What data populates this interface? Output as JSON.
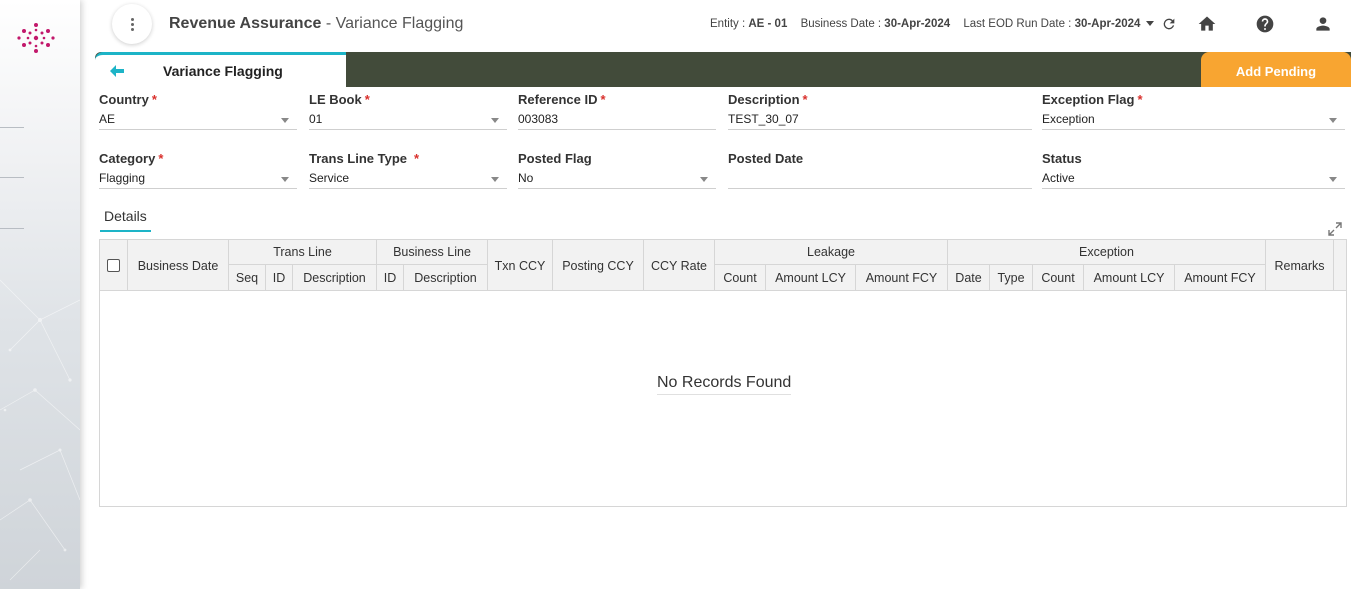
{
  "header": {
    "app_title": "Revenue Assurance",
    "page_title": " - Variance Flagging",
    "entity_label": "Entity : ",
    "entity_value": "AE - 01",
    "business_date_label": "Business Date : ",
    "business_date_value": "30-Apr-2024",
    "eod_label": "Last EOD Run Date : ",
    "eod_value": "30-Apr-2024",
    "icons": [
      "refresh-icon",
      "home-icon",
      "help-icon",
      "user-icon"
    ]
  },
  "tab": {
    "label": "Variance Flagging",
    "back_icon": "arrow-left-icon"
  },
  "actions": {
    "add_pending": "Add Pending"
  },
  "form": {
    "country": {
      "label": "Country",
      "required": "*",
      "value": "AE"
    },
    "le_book": {
      "label": "LE Book",
      "required": "*",
      "value": "01"
    },
    "reference_id": {
      "label": "Reference ID",
      "required": "*",
      "value": "003083"
    },
    "description": {
      "label": "Description",
      "required": "*",
      "value": "TEST_30_07"
    },
    "exception_flag": {
      "label": "Exception Flag",
      "required": "*",
      "value": "Exception"
    },
    "category": {
      "label": "Category",
      "required": "*",
      "value": "Flagging"
    },
    "trans_line_type": {
      "label": "Trans Line Type",
      "required": "*",
      "value": "Service"
    },
    "posted_flag": {
      "label": "Posted Flag",
      "value": "No"
    },
    "posted_date": {
      "label": "Posted Date",
      "value": ""
    },
    "status": {
      "label": "Status",
      "value": "Active"
    }
  },
  "details": {
    "tab_label": "Details",
    "columns": {
      "business_date": "Business Date",
      "trans_line": "Trans Line",
      "seq": "Seq",
      "tl_id": "ID",
      "tl_desc": "Description",
      "business_line": "Business Line",
      "bl_id": "ID",
      "bl_desc": "Description",
      "txn_ccy": "Txn CCY",
      "posting_ccy": "Posting CCY",
      "ccy_rate": "CCY Rate",
      "leakage": "Leakage",
      "lk_count": "Count",
      "lk_amount_lcy": "Amount LCY",
      "lk_amount_fcy": "Amount FCY",
      "exception": "Exception",
      "ex_date": "Date",
      "ex_type": "Type",
      "ex_count": "Count",
      "ex_amount_lcy": "Amount LCY",
      "ex_amount_fcy": "Amount FCY",
      "remarks": "Remarks"
    },
    "rows": [],
    "empty_message": "No Records Found"
  }
}
